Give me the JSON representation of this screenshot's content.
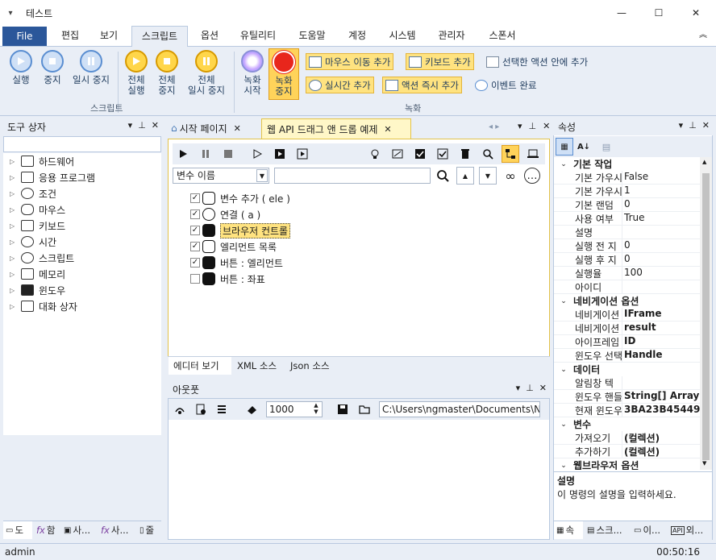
{
  "window": {
    "title": "테스트",
    "quick_access": "▾",
    "minimize": "—",
    "maximize": "☐",
    "close": "✕"
  },
  "menu": {
    "file": "File",
    "items": [
      "편집",
      "보기",
      "스크립트",
      "옵션",
      "유틸리티",
      "도움말",
      "계정",
      "시스템",
      "관리자",
      "스폰서"
    ],
    "active_index": 2,
    "collapse": "︽"
  },
  "ribbon": {
    "script_group": "스크립트",
    "record_group": "녹화",
    "run": "실행",
    "stop": "중지",
    "pause": "일시 중지",
    "all_run_1": "전체",
    "all_run_2": "실행",
    "all_stop_1": "전체",
    "all_stop_2": "중지",
    "all_pause_1": "전체",
    "all_pause_2": "일시 중지",
    "rec_start_1": "녹화",
    "rec_start_2": "시작",
    "rec_stop_1": "녹화",
    "rec_stop_2": "중지",
    "mouse_move": "마우스 이동 추가",
    "keyboard": "키보드 추가",
    "add_in_action": "선택한 액션 안에 추가",
    "realtime": "실시간 추가",
    "action_now": "액션 즉시 추가",
    "event_done": "이벤트 완료"
  },
  "left_panel": {
    "title": "도구 상자",
    "items": [
      "하드웨어",
      "응용 프로그램",
      "조건",
      "마우스",
      "키보드",
      "시간",
      "스크립트",
      "메모리",
      "윈도우",
      "대화 상자"
    ],
    "tabs": [
      "도",
      "함",
      "사...",
      "사...",
      "줄"
    ]
  },
  "editor": {
    "tab_start": "시작 페이지",
    "tab_active": "웹 API 드래그 앤 드롭 예제",
    "var_combo": "변수 이름",
    "search_placeholder": "",
    "items": [
      {
        "label": "변수 추가 ( ele )",
        "checked": true
      },
      {
        "label": "연결 ( a )",
        "checked": true
      },
      {
        "label": "브라우저 컨트롤",
        "checked": true
      },
      {
        "label": "엘리먼트 목록",
        "checked": true
      },
      {
        "label": "버튼 : 엘리먼트",
        "checked": true
      },
      {
        "label": "버튼 : 좌표",
        "checked": false
      }
    ],
    "bottom_tabs": [
      "에디터 보기",
      "XML 소스",
      "Json 소스"
    ]
  },
  "output": {
    "title": "아웃풋",
    "count_value": "1000",
    "path": "C:\\Users\\ngmaster\\Documents\\NGM"
  },
  "props": {
    "title": "속성",
    "categories": [
      {
        "name": "기본 작업",
        "rows": [
          [
            "기본 가우시",
            "False"
          ],
          [
            "기본 가우시",
            "1"
          ],
          [
            "기본 랜덤",
            "0"
          ],
          [
            "사용 여부",
            "True"
          ],
          [
            "설명",
            ""
          ],
          [
            "실행 전 지",
            "0"
          ],
          [
            "실행 후 지",
            "0"
          ],
          [
            "실행율",
            "100"
          ],
          [
            "아이디",
            ""
          ]
        ]
      },
      {
        "name": "네비게이션 옵션",
        "rows": [
          [
            "네비게이션",
            "IFrame"
          ],
          [
            "네비게이션",
            "result"
          ],
          [
            "아이프레임",
            "ID"
          ],
          [
            "윈도우 선택",
            "Handle"
          ]
        ]
      },
      {
        "name": "데이터",
        "rows": [
          [
            "알림창 텍",
            ""
          ],
          [
            "윈도우 핸들",
            "String[] Array"
          ],
          [
            "현재 윈도우",
            "3BA23B454497D"
          ]
        ]
      },
      {
        "name": "변수",
        "rows": [
          [
            "가져오기",
            "(컬렉션)"
          ],
          [
            "추가하기",
            "(컬렉션)"
          ]
        ]
      },
      {
        "name": "웹브라우저 옵션",
        "rows": []
      }
    ],
    "desc_title": "설명",
    "desc_text": "이 명령의 설명을 입력하세요.",
    "tabs": [
      "속",
      "스크...",
      "이...",
      "외..."
    ]
  },
  "status": {
    "user": "admin",
    "time": "00:50:16"
  },
  "colors": {
    "file": "#2b579a",
    "accent": "#5a8ed1",
    "orange": "#ffd64a",
    "record": "#e8261c"
  }
}
